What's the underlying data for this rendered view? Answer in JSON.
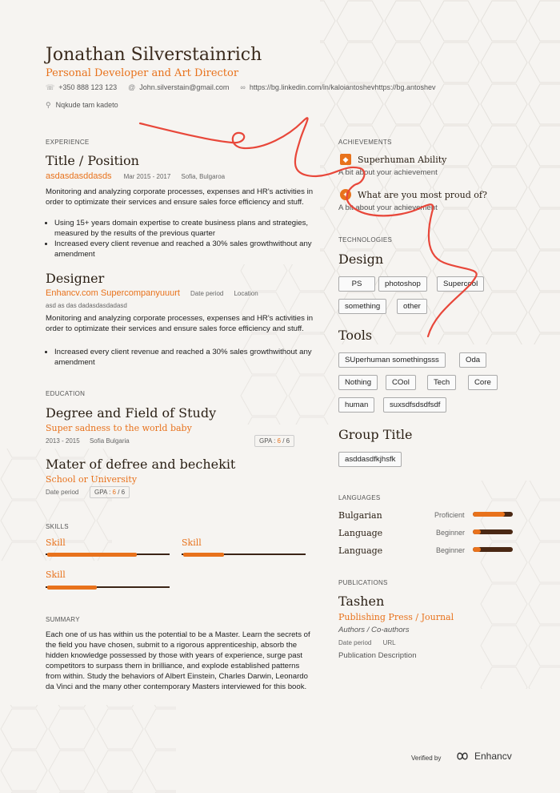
{
  "header": {
    "name": "Jonathan Silverstainrich",
    "title": "Personal Developer and Art Director",
    "phone": "+350 888 123 123",
    "email": "John.silverstain@gmail.com",
    "link": "https://bg.linkedin.com/in/kaloiantoshevhttps://bg.antoshev",
    "address": "Nqkude tam kadeto"
  },
  "experience": {
    "section_title": "EXPERIENCE",
    "jobs": [
      {
        "title": "Title / Position",
        "company": "asdasdasddasds",
        "date": "Mar 2015 - 2017",
        "location": "Sofia, Bulgaroa",
        "description": "Monitoring and analyzing corporate processes, expenses and HR's activities in order to optimizate their services and ensure sales force efficiency and stuff.",
        "bullets": [
          "Using 15+ years domain expertise to create business plans and strategies, measured by the results of the previous quarter",
          "Increased every client revenue and reached a 30% sales growthwithout any amendment"
        ]
      },
      {
        "title": "Designer",
        "company": "Enhancv.com Supercompanyuuurt",
        "date": "Date period",
        "location": "Location",
        "subtitle": "asd as das dadasdasdadasd",
        "description": "Monitoring and analyzing corporate processes, expenses and HR's activities in order to optimizate their services and ensure sales force efficiency and stuff.",
        "bullets": [
          "Increased every client revenue and reached a 30% sales growthwithout any amendment"
        ]
      }
    ]
  },
  "education": {
    "section_title": "EDUCATION",
    "items": [
      {
        "degree": "Degree and Field of Study",
        "school": "Super sadness to the world baby",
        "date": "2013 - 2015",
        "location": "Sofia Bulgaria",
        "gpa_label": "GPA :",
        "gpa": "6",
        "gpa_max": "6"
      },
      {
        "degree": "Mater of defree and bechekit",
        "school": "School or University",
        "date": "Date period",
        "gpa_label": "GPA :",
        "gpa": "6",
        "gpa_max": "6"
      }
    ]
  },
  "skills": {
    "section_title": "SKILLS",
    "items": [
      {
        "label": "Skill",
        "level": 0.72
      },
      {
        "label": "Skill",
        "level": 0.33
      },
      {
        "label": "Skill",
        "level": 0.4
      }
    ]
  },
  "summary": {
    "section_title": "SUMMARY",
    "text": "Each one of us has within us the potential to be a Master. Learn the secrets of the field you have chosen, submit to a rigorous apprenticeship, absorb the hidden knowledge possessed by those with years of experience, surge past competitors to surpass them in brilliance, and explode established patterns from within. Study the behaviors of Albert Einstein, Charles Darwin, Leonardo da Vinci and the many other contemporary Masters interviewed for this book."
  },
  "achievements": {
    "section_title": "ACHIEVEMENTS",
    "items": [
      {
        "title": "Superhuman Ability",
        "desc": "A bit about your achievement",
        "icon": "cat-icon"
      },
      {
        "title": "What are you most proud of?",
        "desc": "A bit about your achievement",
        "icon": "award-icon"
      }
    ]
  },
  "technologies": {
    "section_title": "TECHNOLOGIES",
    "groups": [
      {
        "title": "Design",
        "tags": [
          "PS",
          "photoshop",
          "Supercool",
          "something",
          "other"
        ]
      },
      {
        "title": "Tools",
        "tags": [
          "SUperhuman somethingsss",
          "Oda",
          "Nothing",
          "COol",
          "Tech",
          "Core",
          "human",
          "suxsdfsdsdfsdf"
        ]
      },
      {
        "title": "Group Title",
        "tags": [
          "asddasdfkjhsfk"
        ]
      }
    ]
  },
  "languages": {
    "section_title": "LANGUAGES",
    "items": [
      {
        "name": "Bulgarian",
        "level": "Proficient",
        "fill": 0.8
      },
      {
        "name": "Language",
        "level": "Beginner",
        "fill": 0.2
      },
      {
        "name": "Language",
        "level": "Beginner",
        "fill": 0.2
      }
    ]
  },
  "publications": {
    "section_title": "PUBLICATIONS",
    "title": "Tashen",
    "publisher": "Publishing Press / Journal",
    "authors": "Authors / Co-authors",
    "date": "Date period",
    "url": "URL",
    "description": "Publication Description"
  },
  "footer": {
    "verified": "Verified by",
    "brand": "Enhancv"
  },
  "colors": {
    "accent": "#e8721c",
    "dark": "#3b2416",
    "scribble": "#e8473a"
  }
}
